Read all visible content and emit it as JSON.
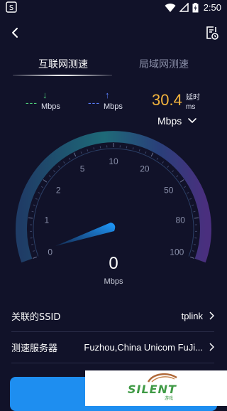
{
  "status_bar": {
    "time": "2:50"
  },
  "tabs": [
    {
      "label": "互联网测速",
      "active": true
    },
    {
      "label": "局域网测速",
      "active": false
    }
  ],
  "metrics": {
    "download": {
      "value": "---",
      "unit": "Mbps",
      "color": "#4fd07a"
    },
    "upload": {
      "value": "---",
      "unit": "Mbps",
      "color": "#5b7fff"
    },
    "ping": {
      "value": "30.4",
      "label": "延时",
      "unit": "ms",
      "color": "#f2b33d"
    }
  },
  "unit_selector": {
    "value": "Mbps"
  },
  "gauge": {
    "scale": [
      "0",
      "1",
      "2",
      "5",
      "10",
      "20",
      "50",
      "80",
      "100"
    ],
    "needle_value": 0
  },
  "speed": {
    "value": "0",
    "unit": "Mbps"
  },
  "info_rows": [
    {
      "label": "关联的SSID",
      "value": "tplink"
    },
    {
      "label": "测速服务器",
      "value": "Fuzhou,China Unicom FuJi..."
    }
  ],
  "watermark": {
    "text": "SILENT",
    "subtext": "游戏"
  },
  "colors": {
    "background": "#111229",
    "accent": "#1e8ef0"
  }
}
